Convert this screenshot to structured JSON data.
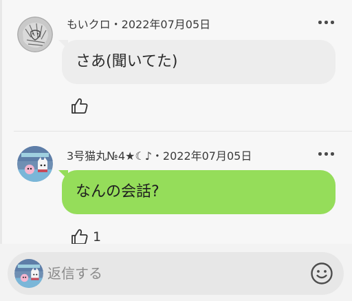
{
  "thread": {
    "comments": [
      {
        "author": "もいクロ",
        "date": "2022年07月05日",
        "meta": "もいクロ・2022年07月05日",
        "text": "さあ(聞いてた)",
        "bubble_color": "#ededed",
        "like_count": null,
        "avatar_icon": "gray-sketch-avatar"
      },
      {
        "author": "3号猫丸№4★☾♪",
        "date": "2022年07月05日",
        "meta": "3号猫丸№4★☾♪・2022年07月05日",
        "text": "なんの会話?",
        "bubble_color": "#95dd5a",
        "like_count": "1",
        "avatar_icon": "character-avatar"
      }
    ],
    "more_icon": "more-horizontal-icon",
    "like_icon": "thumbs-up-icon"
  },
  "reply": {
    "placeholder": "返信する",
    "avatar_icon": "character-avatar",
    "emoji_icon": "smiley-icon"
  },
  "colors": {
    "thread_background": "#f7f7f7",
    "gray_bubble": "#ededed",
    "green_bubble": "#95dd5a",
    "reply_background": "#f3f3f3",
    "reply_input": "#e7e7e7"
  }
}
